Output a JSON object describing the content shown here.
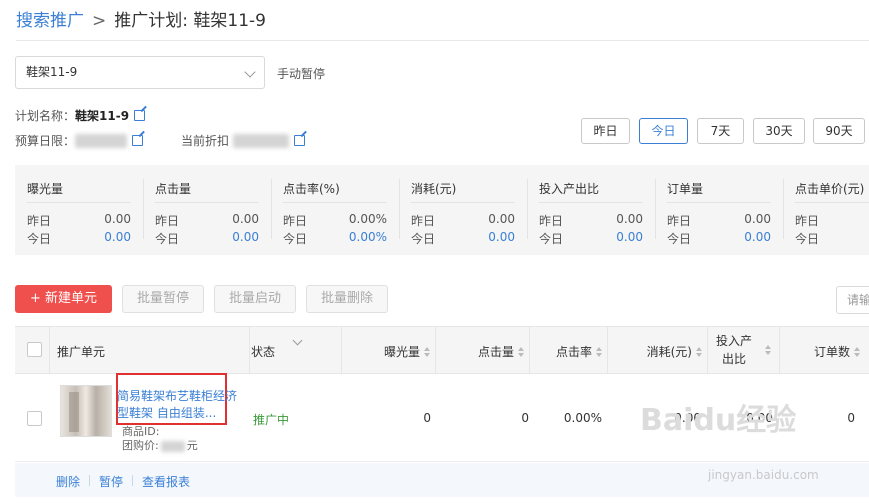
{
  "breadcrumb": {
    "root": "搜索推广",
    "separator": ">",
    "current": "推广计划: 鞋架11-9"
  },
  "plan_select": {
    "value": "鞋架11-9"
  },
  "status_label": "手动暂停",
  "plan_info": {
    "name_label": "计划名称：",
    "name_value": "鞋架11-9",
    "budget_label": "预算日限：",
    "discount_label": "当前折扣"
  },
  "date_buttons": [
    "昨日",
    "今日",
    "7天",
    "30天",
    "90天"
  ],
  "active_date": "今日",
  "stats": [
    {
      "title": "曝光量",
      "yesterday_label": "昨日",
      "yesterday": "0.00",
      "today_label": "今日",
      "today": "0.00"
    },
    {
      "title": "点击量",
      "yesterday_label": "昨日",
      "yesterday": "0.00",
      "today_label": "今日",
      "today": "0.00"
    },
    {
      "title": "点击率(%)",
      "yesterday_label": "昨日",
      "yesterday": "0.00%",
      "today_label": "今日",
      "today": "0.00%"
    },
    {
      "title": "消耗(元)",
      "yesterday_label": "昨日",
      "yesterday": "0.00",
      "today_label": "今日",
      "today": "0.00"
    },
    {
      "title": "投入产出比",
      "yesterday_label": "昨日",
      "yesterday": "0.00",
      "today_label": "今日",
      "today": "0.00"
    },
    {
      "title": "订单量",
      "yesterday_label": "昨日",
      "yesterday": "0.00",
      "today_label": "今日",
      "today": "0.00"
    },
    {
      "title": "点击单价(元)",
      "yesterday_label": "昨日",
      "yesterday": "",
      "today_label": "今日",
      "today": ""
    }
  ],
  "actions": {
    "new_unit": "+ 新建单元",
    "batch_pause": "批量暂停",
    "batch_start": "批量启动",
    "batch_delete": "批量删除",
    "search_placeholder": "请输"
  },
  "table": {
    "headers": {
      "unit": "推广单元",
      "status": "状态",
      "impressions": "曝光量",
      "clicks": "点击量",
      "ctr": "点击率",
      "cost": "消耗(元)",
      "roi_line1": "投入产",
      "roi_line2": "出比",
      "orders": "订单数"
    },
    "rows": [
      {
        "title": "简易鞋架布艺鞋柜经济型鞋架 自由组装...",
        "product_id_label": "商品ID:",
        "group_price_label": "团购价:",
        "group_price_suffix": "元",
        "status": "推广中",
        "impressions": "0",
        "clicks": "0",
        "ctr": "0.00%",
        "cost": "0.00",
        "roi": "0.00",
        "orders": "0"
      }
    ],
    "row_ops": [
      "删除",
      "暂停",
      "查看报表"
    ]
  },
  "watermark": {
    "main": "Baidu经验",
    "sub": "jingyan.baidu.com"
  },
  "colors": {
    "accent": "#3a7fd5",
    "danger": "#f0504d",
    "status_green": "#3a9b3a"
  }
}
